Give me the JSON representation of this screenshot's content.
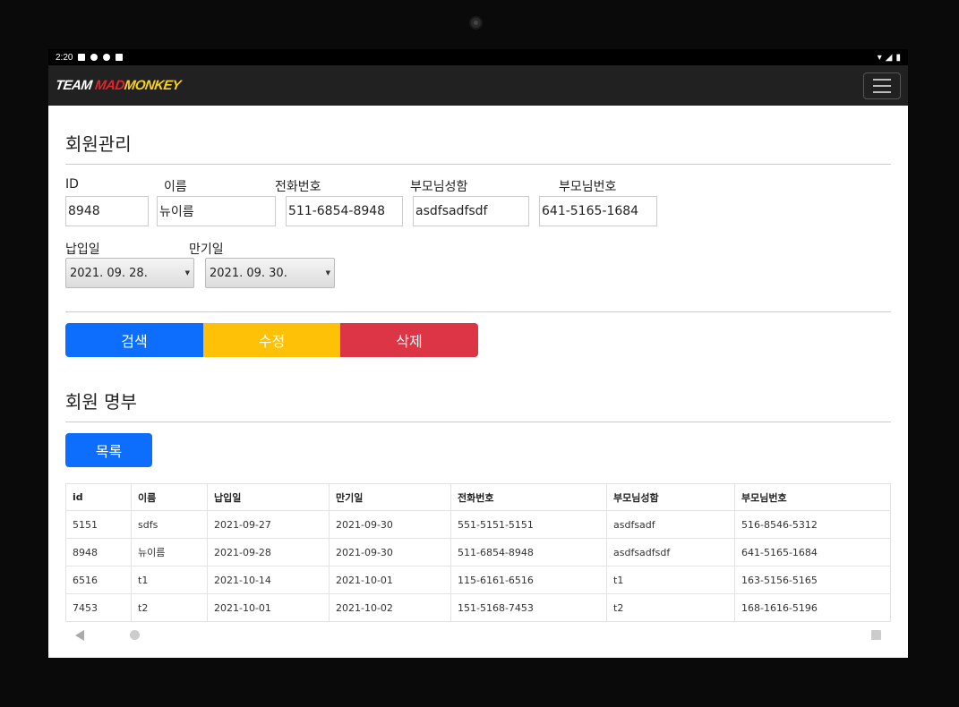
{
  "status": {
    "time": "2:20"
  },
  "brand": {
    "part1": "TEAM ",
    "part2": "MAD",
    "part3": "MONKEY"
  },
  "form": {
    "title": "회원관리",
    "labels": {
      "id": "ID",
      "name": "이름",
      "phone": "전화번호",
      "parent_name": "부모님성함",
      "parent_phone": "부모님번호",
      "pay_date": "납입일",
      "exp_date": "만기일"
    },
    "values": {
      "id": "8948",
      "name": "뉴이름",
      "phone": "511-6854-8948",
      "parent_name": "asdfsadfsdf",
      "parent_phone": "641-5165-1684",
      "pay_date": "2021. 09. 28.",
      "exp_date": "2021. 09. 30."
    },
    "buttons": {
      "search": "검색",
      "edit": "수정",
      "delete": "삭제"
    }
  },
  "list": {
    "title": "회원 명부",
    "button": "목록",
    "columns": [
      "id",
      "이름",
      "납입일",
      "만기일",
      "전화번호",
      "부모님성함",
      "부모님번호"
    ],
    "rows": [
      [
        "5151",
        "sdfs",
        "2021-09-27",
        "2021-09-30",
        "551-5151-5151",
        "asdfsadf",
        "516-8546-5312"
      ],
      [
        "8948",
        "뉴이름",
        "2021-09-28",
        "2021-09-30",
        "511-6854-8948",
        "asdfsadfsdf",
        "641-5165-1684"
      ],
      [
        "6516",
        "t1",
        "2021-10-14",
        "2021-10-01",
        "115-6161-6516",
        "t1",
        "163-5156-5165"
      ],
      [
        "7453",
        "t2",
        "2021-10-01",
        "2021-10-02",
        "151-5168-7453",
        "t2",
        "168-1616-5196"
      ]
    ]
  },
  "colors": {
    "primary": "#0d6efd",
    "warning": "#ffc107",
    "danger": "#dc3545",
    "navbar": "#212121"
  }
}
